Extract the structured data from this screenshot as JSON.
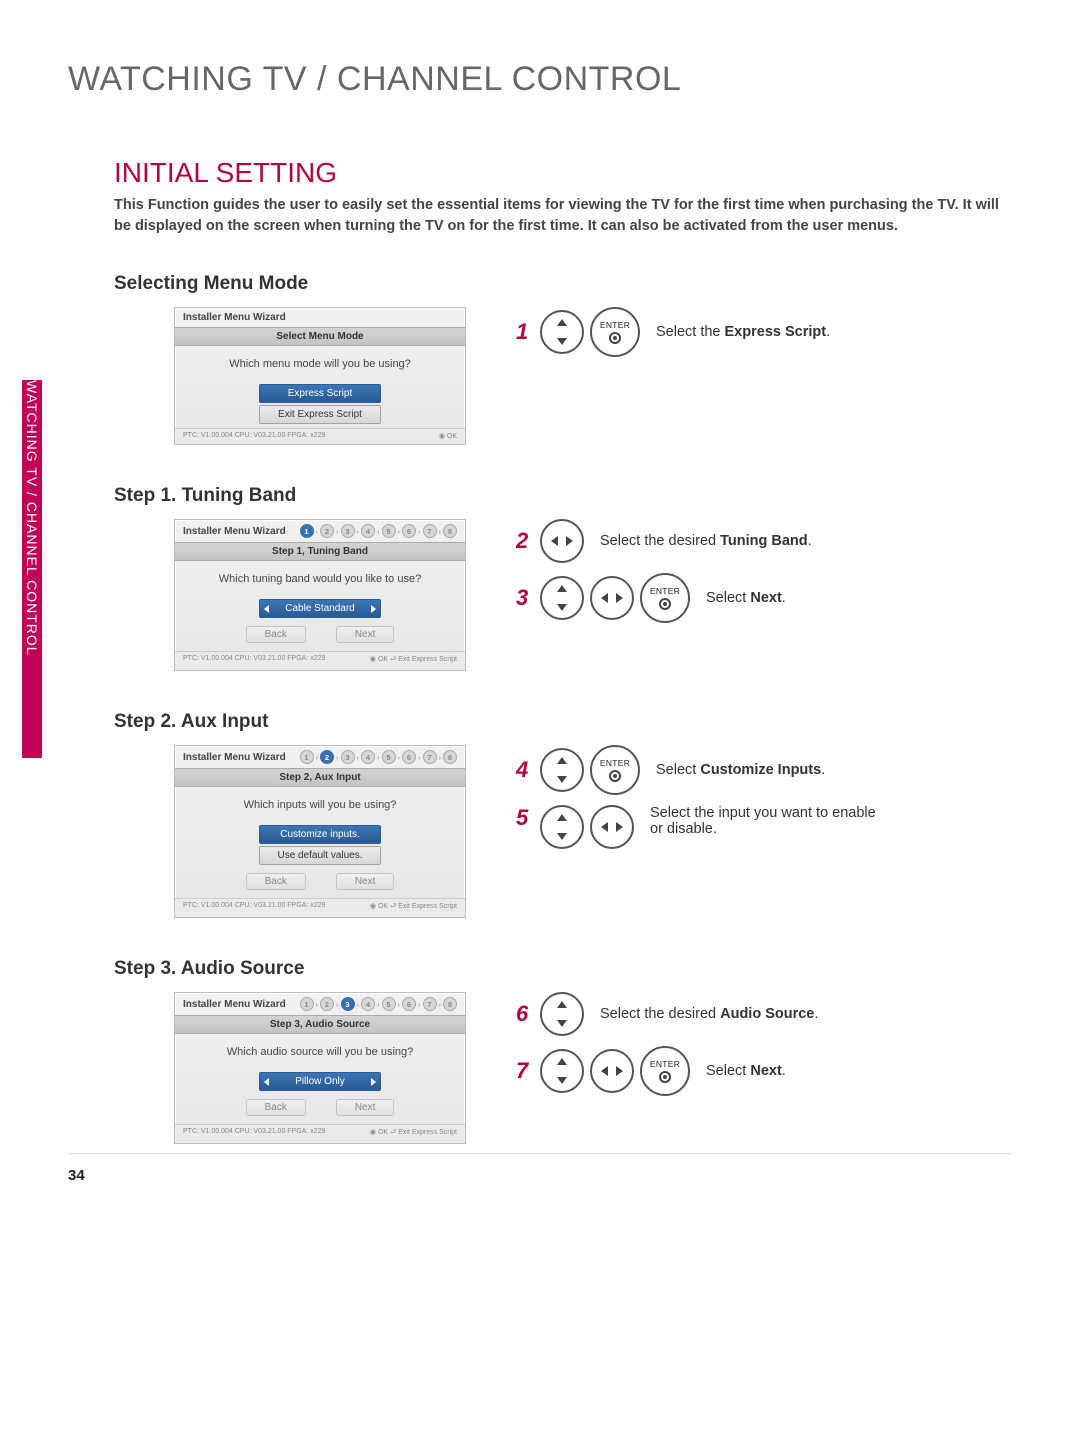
{
  "page_number": "34",
  "h1": "WATCHING TV / CHANNEL CONTROL",
  "side_tab": "WATCHING TV / CHANNEL CONTROL",
  "h2": "INITIAL SETTING",
  "intro": "This Function guides the user to easily set the essential items for viewing the TV for the first time when purchasing the TV. It will be displayed on the screen when turning the TV on for the first time. It can also be activated from the user menus.",
  "buttons": {
    "enter": "ENTER"
  },
  "wizard": {
    "title": "Installer Menu Wizard",
    "ptc": "PTC: V1.00.004 CPU: V03.21.00 FPGA: x229",
    "ok_short": "◉ OK",
    "ok_long": "◉ OK  ⮐ Exit Express Script",
    "steps": [
      "1",
      "2",
      "3",
      "4",
      "5",
      "6",
      "7",
      "8"
    ]
  },
  "sections": {
    "menu_mode": {
      "heading": "Selecting Menu Mode",
      "bar": "Select Menu Mode",
      "question": "Which menu mode will you be using?",
      "opts": [
        "Express Script",
        "Exit Express Script"
      ],
      "step1_num": "1",
      "step1_text_prefix": "Select the ",
      "step1_bold": "Express Script",
      "step1_suffix": "."
    },
    "tuning": {
      "heading": "Step 1. Tuning Band",
      "bar": "Step 1, Tuning Band",
      "question": "Which tuning band would you like to use?",
      "opt": "Cable Standard",
      "back": "Back",
      "next": "Next",
      "step2_num": "2",
      "step2_text_prefix": "Select the desired ",
      "step2_bold": "Tuning Band",
      "step2_suffix": ".",
      "step3_num": "3",
      "step3_text_prefix": "Select ",
      "step3_bold": "Next",
      "step3_suffix": "."
    },
    "aux": {
      "heading": "Step 2. Aux Input",
      "bar": "Step 2, Aux Input",
      "question": "Which inputs will you be using?",
      "opts": [
        "Customize inputs.",
        "Use default values."
      ],
      "back": "Back",
      "next": "Next",
      "step4_num": "4",
      "step4_text_prefix": "Select ",
      "step4_bold": "Customize Inputs",
      "step4_suffix": ".",
      "step5_num": "5",
      "step5_text": "Select the input you want to enable or disable."
    },
    "audio": {
      "heading": "Step 3. Audio Source",
      "bar": "Step 3, Audio Source",
      "question": "Which audio source will you be using?",
      "opt": "Pillow Only",
      "back": "Back",
      "next": "Next",
      "step6_num": "6",
      "step6_text_prefix": "Select the desired ",
      "step6_bold": "Audio Source",
      "step6_suffix": ".",
      "step7_num": "7",
      "step7_text_prefix": "Select ",
      "step7_bold": "Next",
      "step7_suffix": "."
    }
  }
}
